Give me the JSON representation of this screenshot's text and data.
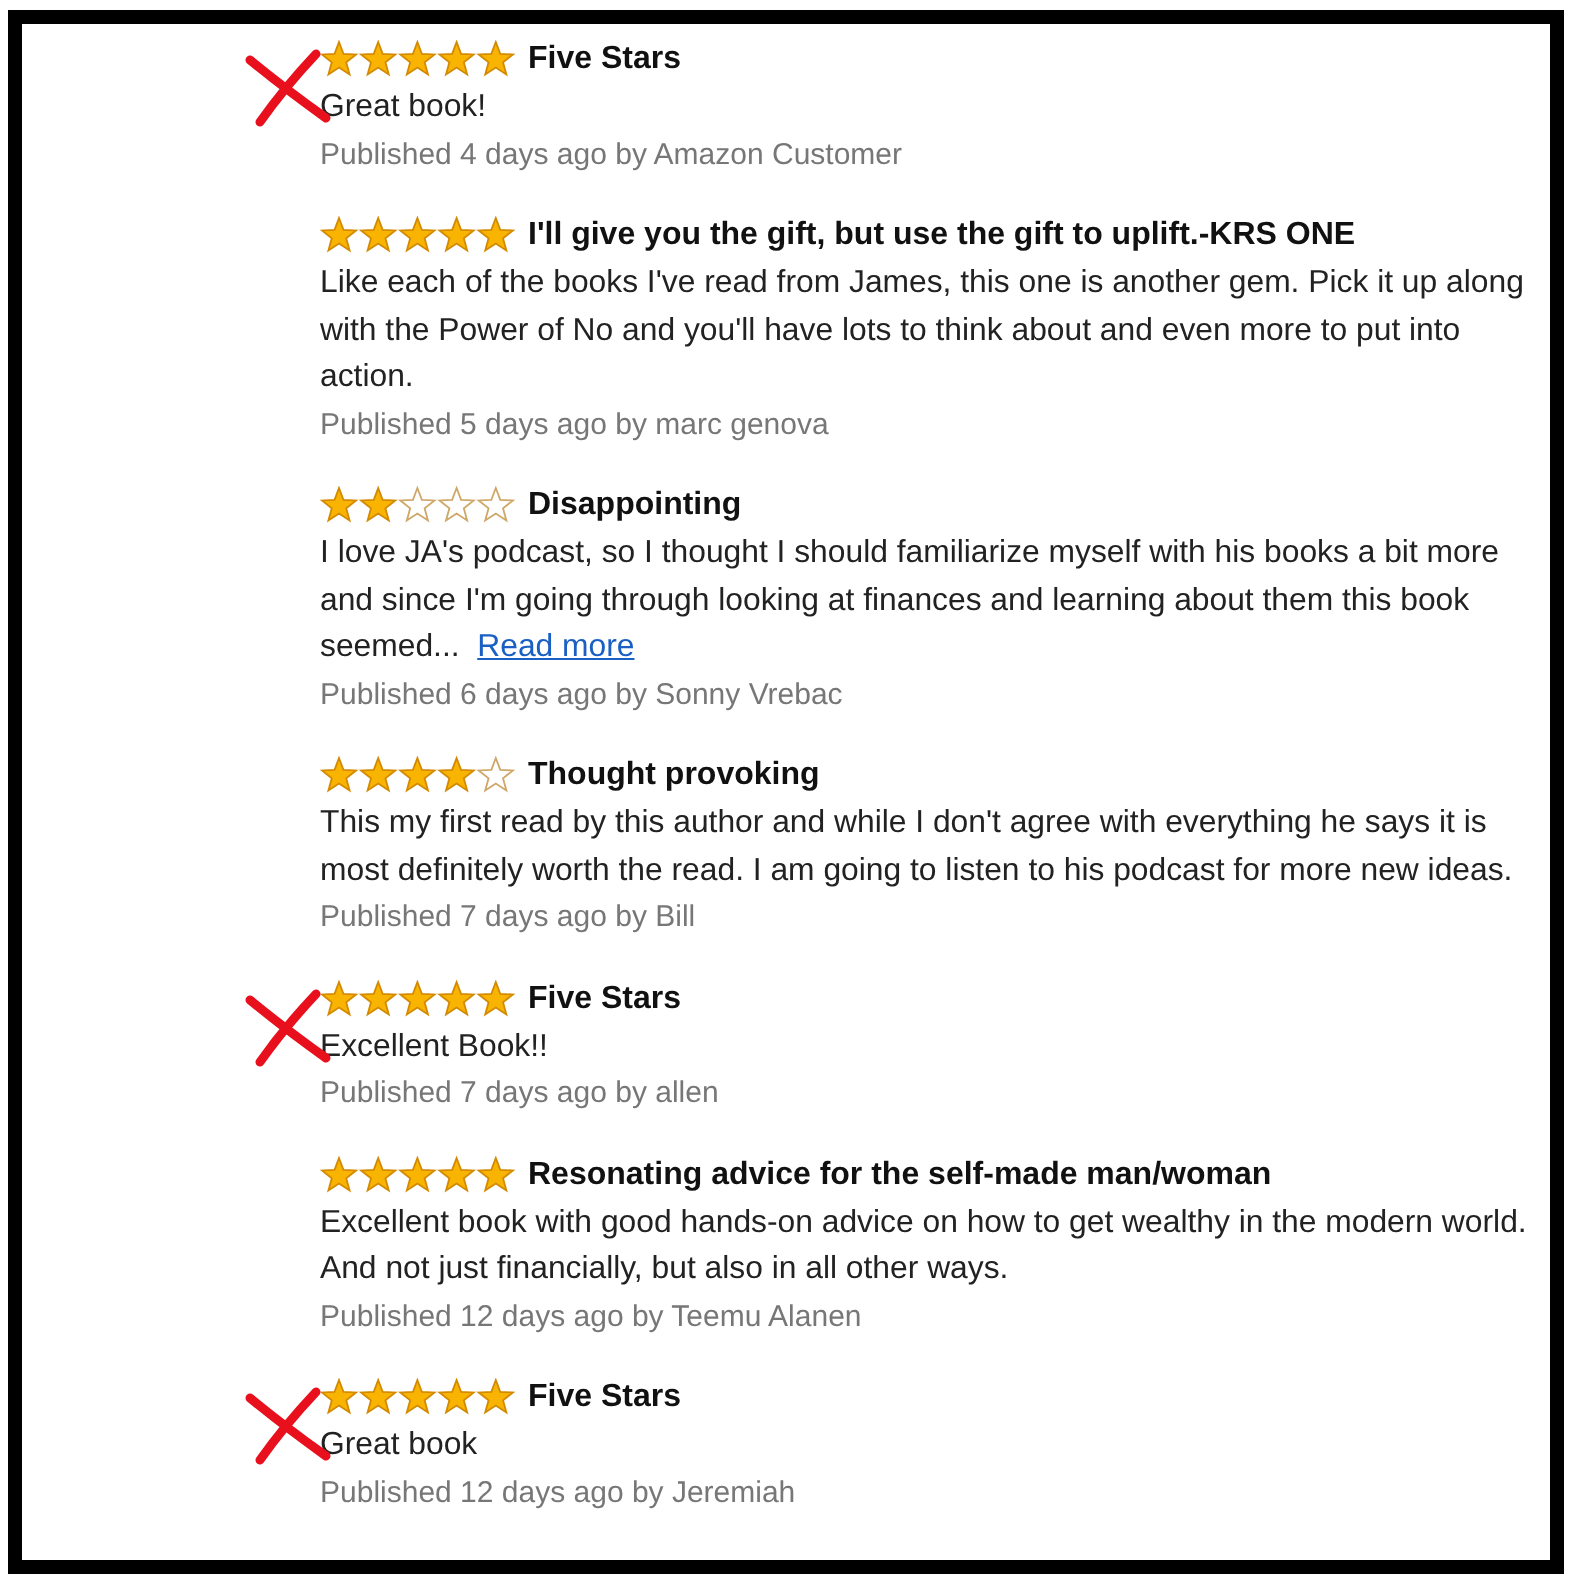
{
  "reviews": [
    {
      "stars": 5,
      "title": "Five Stars",
      "body": "Great book!",
      "meta": "Published 4 days ago by Amazon Customer",
      "marked": true
    },
    {
      "stars": 5,
      "title": "I'll give you the gift, but use the gift to uplift.-KRS ONE",
      "body": "Like each of the books I've read from James, this one is another gem. Pick it up along with the Power of No and you'll have lots to think about and even more to put into action.",
      "meta": "Published 5 days ago by marc genova",
      "marked": false
    },
    {
      "stars": 2,
      "title": "Disappointing",
      "body": "I love JA's podcast, so I thought I should familiarize myself with his books a bit more and since I'm going through looking at finances and learning about them this book seemed...",
      "link": "Read more",
      "meta": "Published 6 days ago by Sonny Vrebac",
      "marked": false
    },
    {
      "stars": 4,
      "title": "Thought provoking",
      "body": "This my first read by this author and while I don't agree with everything he says it is most definitely worth the read. I am going to listen to his podcast for more new ideas.",
      "meta": "Published 7 days ago by Bill",
      "marked": false
    },
    {
      "stars": 5,
      "title": "Five Stars",
      "body": "Excellent Book!!",
      "meta": "Published 7 days ago by allen",
      "marked": true
    },
    {
      "stars": 5,
      "title": "Resonating advice for the self-made man/woman",
      "body": "Excellent book with good hands-on advice on how to get wealthy in the modern world. And not just financially, but also in all other ways.",
      "meta": "Published 12 days ago by Teemu Alanen",
      "marked": false
    },
    {
      "stars": 5,
      "title": "Five Stars",
      "body": "Great book",
      "meta": "Published 12 days ago by Jeremiah",
      "marked": true
    }
  ]
}
